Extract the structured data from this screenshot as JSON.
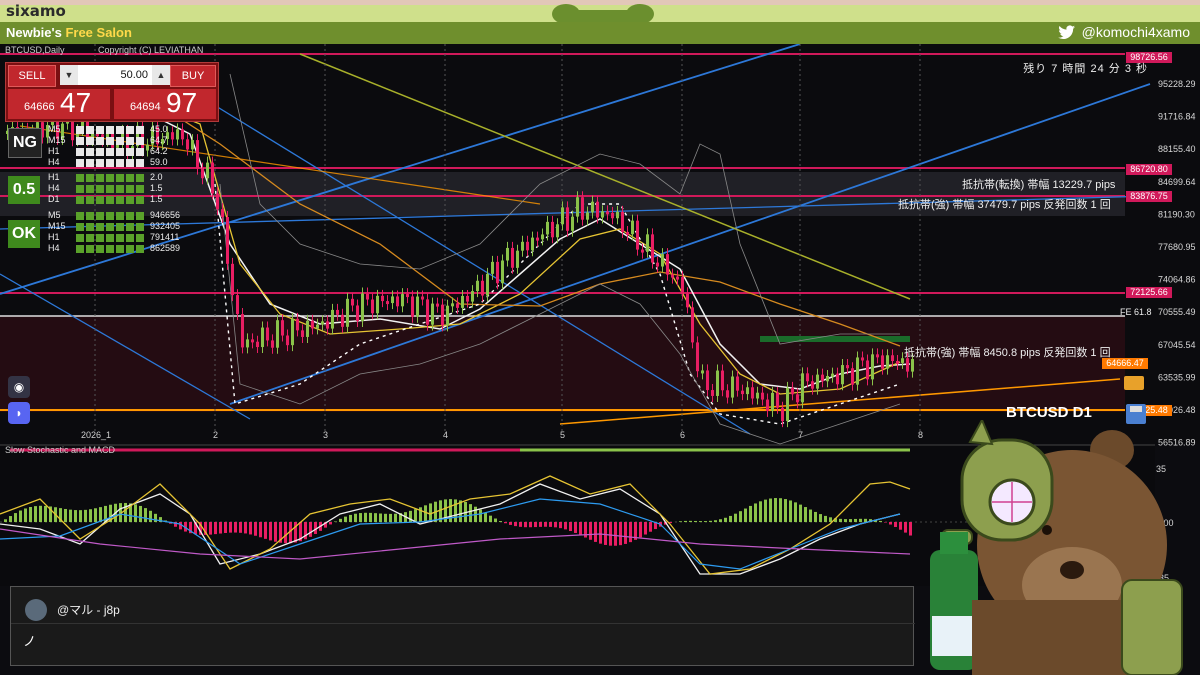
{
  "stream": {
    "brand": "sixamo",
    "salon_prefix": "Newbie's ",
    "salon_highlight": "Free Salon",
    "twitter_handle": "@komochi4xamo"
  },
  "chart": {
    "symbol": "BTCUSD,Daily",
    "copyright": "Copyright (C) LEVIATHAN",
    "countdown": "残り 7 時間 24 分 3 秒",
    "instrument_label": "BTCUSD D1",
    "y_ticks": [
      "95228.29",
      "91716.84",
      "88155.40",
      "84699.64",
      "81190.30",
      "77680.95",
      "74064.86",
      "70555.49",
      "67045.54",
      "63535.99",
      "60026.48",
      "56516.89"
    ],
    "x_ticks": [
      "2026_1",
      "2",
      "3",
      "4",
      "5",
      "6",
      "7",
      "8"
    ],
    "price_tags": [
      {
        "text": "98726.56",
        "color": "#d0195a"
      },
      {
        "text": "86720.80",
        "color": "#d0195a"
      },
      {
        "text": "83876.75",
        "color": "#d0195a"
      },
      {
        "text": "72125.66",
        "color": "#d0195a"
      },
      {
        "text": "64666.47",
        "color": "#ff7a00"
      },
      {
        "text": "59425.48",
        "color": "#ff7a00"
      }
    ],
    "fe_label": "FE 61.8",
    "current_price_label": "64666.47",
    "annotations": {
      "resist_turn": "抵抗帯(転換) 帯幅 13229.7 pips",
      "resist_strong_1": "抵抗帯(強) 帯幅 37479.7 pips 反発回数 1 回",
      "resist_strong_2": "抵抗帯(強) 帯幅 8450.8 pips 反発回数 1 回",
      "bottom_tag": "64666.47"
    }
  },
  "trade_panel": {
    "sell_label": "SELL",
    "buy_label": "BUY",
    "lot": "50.00",
    "bid_small": "64666",
    "bid_big": "47",
    "ask_small": "64694",
    "ask_big": "97"
  },
  "signal_panel": {
    "badge_ng": "NG",
    "badge_05": "0.5",
    "badge_ok": "OK",
    "group1": [
      {
        "tf": "M5",
        "val": "45.0"
      },
      {
        "tf": "M15",
        "val": "64.7"
      },
      {
        "tf": "H1",
        "val": "64.2"
      },
      {
        "tf": "H4",
        "val": "59.0"
      }
    ],
    "group2": [
      {
        "tf": "H1",
        "val": "2.0"
      },
      {
        "tf": "H4",
        "val": "1.5"
      },
      {
        "tf": "D1",
        "val": "1.5"
      }
    ],
    "group3": [
      {
        "tf": "M5",
        "val": "946656"
      },
      {
        "tf": "M15",
        "val": "932405"
      },
      {
        "tf": "H1",
        "val": "791411"
      },
      {
        "tf": "H4",
        "val": "862589"
      }
    ]
  },
  "oscillator": {
    "title": "Slow Stochastic and MACD",
    "y_ticks": [
      "35",
      "0.00",
      "-35"
    ]
  },
  "chat": {
    "username": "@マル - j8p",
    "message": "ノ"
  },
  "colors": {
    "bull": "#8bc34a",
    "bear": "#e91e63",
    "resistance": "#d0195a",
    "support": "#ff9800"
  }
}
